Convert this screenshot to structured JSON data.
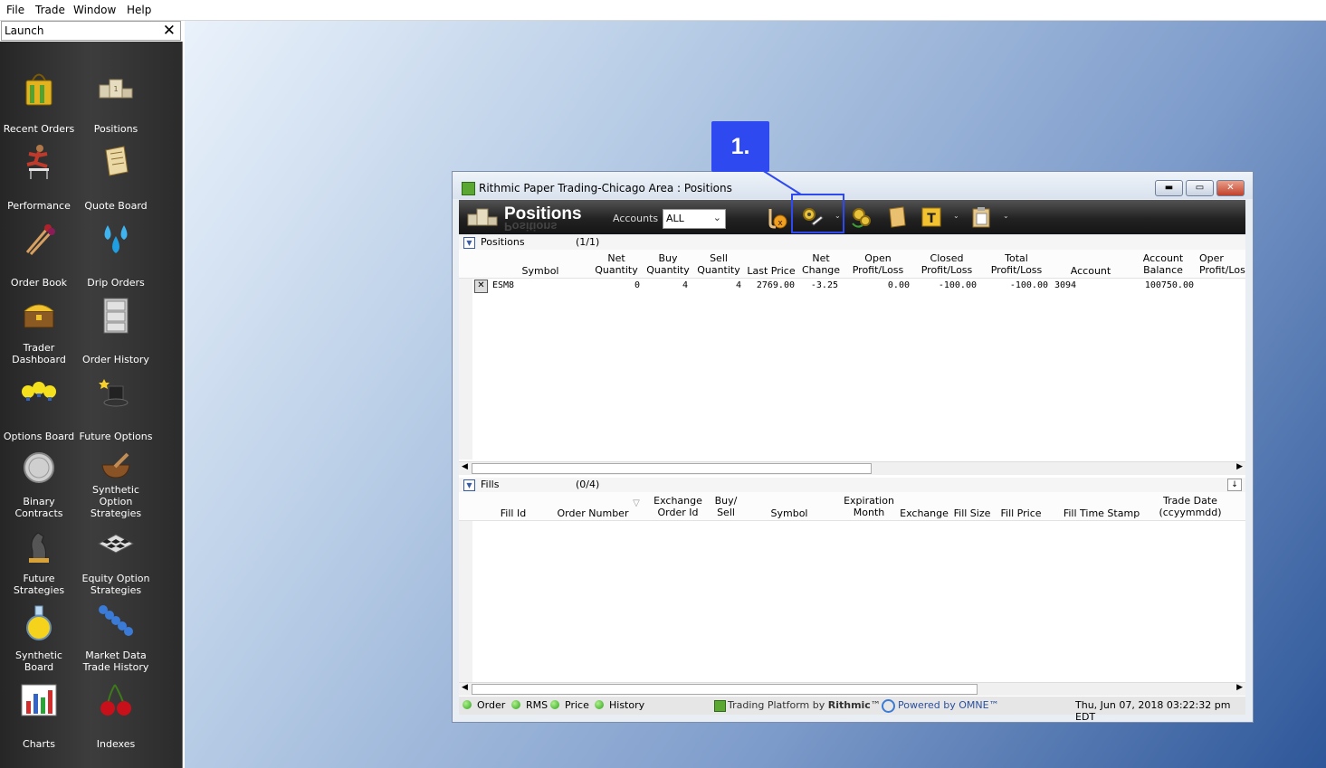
{
  "menu": {
    "items": [
      "File",
      "Trade",
      "Window",
      "Help"
    ]
  },
  "launch": {
    "title": "Launch",
    "close": "✕",
    "tiles": [
      {
        "label": "Recent Orders",
        "icon": "shopping-bag-icon"
      },
      {
        "label": "Positions",
        "icon": "podium-icon"
      },
      {
        "label": "Performance",
        "icon": "hurdler-icon"
      },
      {
        "label": "Quote Board",
        "icon": "scroll-icon"
      },
      {
        "label": "Order Book",
        "icon": "matchsticks-icon"
      },
      {
        "label": "Drip Orders",
        "icon": "water-drops-icon"
      },
      {
        "label": "Trader Dashboard",
        "icon": "treasure-chest-icon"
      },
      {
        "label": "Order History",
        "icon": "file-cabinet-icon"
      },
      {
        "label": "Options Board",
        "icon": "light-bulbs-icon"
      },
      {
        "label": "Future Options",
        "icon": "magic-hat-icon"
      },
      {
        "label": "Binary Contracts",
        "icon": "coin-icon"
      },
      {
        "label": "Synthetic Option Strategies",
        "icon": "mortar-pestle-icon"
      },
      {
        "label": "Future Strategies",
        "icon": "chess-knight-icon"
      },
      {
        "label": "Equity Option Strategies",
        "icon": "chessboard-icon"
      },
      {
        "label": "Synthetic Board",
        "icon": "potion-flask-icon"
      },
      {
        "label": "Market Data Trade History",
        "icon": "beads-icon"
      },
      {
        "label": "Charts",
        "icon": "bar-chart-icon"
      },
      {
        "label": "Indexes",
        "icon": "cherries-icon"
      }
    ]
  },
  "callout": {
    "label": "1."
  },
  "window": {
    "title": "Rithmic Paper Trading-Chicago Area : Positions",
    "minimize": "▬",
    "maximize": "▭",
    "close": "✕",
    "toolbar": {
      "title": "Positions",
      "accounts_label": "Accounts",
      "accounts_value": "ALL",
      "dropdown_arrow": "⌄",
      "icons": [
        "flatten-icon",
        "gears-pencil-icon",
        "gears-refresh-icon",
        "note-icon",
        "text-icon",
        "clipboard-icon"
      ]
    },
    "positions": {
      "name": "Positions",
      "count": "(1/1)",
      "columns": [
        [
          "Symbol"
        ],
        [
          "Net",
          "Quantity"
        ],
        [
          "Buy",
          "Quantity"
        ],
        [
          "Sell",
          "Quantity"
        ],
        [
          "Last Price"
        ],
        [
          "Net",
          "Change"
        ],
        [
          "Open",
          "Profit/Loss"
        ],
        [
          "Closed",
          "Profit/Loss"
        ],
        [
          "Total",
          "Profit/Loss"
        ],
        [
          "Account"
        ],
        [
          "Account",
          "Balance"
        ],
        [
          "Oper",
          "Profit/Los"
        ]
      ],
      "row": {
        "symbol": "ESM8",
        "net_qty": "0",
        "buy_qty": "4",
        "sell_qty": "4",
        "last_price": "2769.00",
        "net_change": "-3.25",
        "open_pl": "0.00",
        "closed_pl": "-100.00",
        "total_pl": "-100.00",
        "account": "3094",
        "balance": "100750.00"
      }
    },
    "fills": {
      "name": "Fills",
      "count": "(0/4)",
      "columns": [
        [
          "Fill Id"
        ],
        [
          "Order Number"
        ],
        [
          "Exchange",
          "Order Id"
        ],
        [
          "Buy/",
          "Sell"
        ],
        [
          "Symbol"
        ],
        [
          "Expiration",
          "Month"
        ],
        [
          "Exchange"
        ],
        [
          "Fill Size"
        ],
        [
          "Fill Price"
        ],
        [
          "Fill Time Stamp"
        ],
        [
          "Trade Date",
          "(ccyymmdd)"
        ]
      ]
    },
    "statusbar": {
      "indicators": [
        "Order",
        "RMS",
        "Price",
        "History"
      ],
      "brand_prefix": "Trading Platform by ",
      "brand_name": "Rithmic",
      "brand_tm": "™",
      "powered": "Powered by OMNE™",
      "datetime": "Thu, Jun 07, 2018 03:22:32 pm EDT"
    },
    "colors": {
      "highlight": "#2f49f0",
      "indicator_green": "#2da31c"
    }
  }
}
